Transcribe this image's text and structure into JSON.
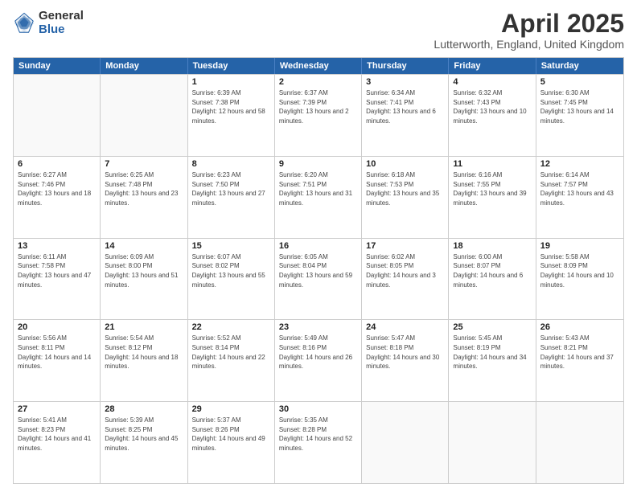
{
  "logo": {
    "general": "General",
    "blue": "Blue"
  },
  "header": {
    "month_year": "April 2025",
    "location": "Lutterworth, England, United Kingdom"
  },
  "days_of_week": [
    "Sunday",
    "Monday",
    "Tuesday",
    "Wednesday",
    "Thursday",
    "Friday",
    "Saturday"
  ],
  "weeks": [
    [
      {
        "day": "",
        "sunrise": "",
        "sunset": "",
        "daylight": ""
      },
      {
        "day": "",
        "sunrise": "",
        "sunset": "",
        "daylight": ""
      },
      {
        "day": "1",
        "sunrise": "Sunrise: 6:39 AM",
        "sunset": "Sunset: 7:38 PM",
        "daylight": "Daylight: 12 hours and 58 minutes."
      },
      {
        "day": "2",
        "sunrise": "Sunrise: 6:37 AM",
        "sunset": "Sunset: 7:39 PM",
        "daylight": "Daylight: 13 hours and 2 minutes."
      },
      {
        "day": "3",
        "sunrise": "Sunrise: 6:34 AM",
        "sunset": "Sunset: 7:41 PM",
        "daylight": "Daylight: 13 hours and 6 minutes."
      },
      {
        "day": "4",
        "sunrise": "Sunrise: 6:32 AM",
        "sunset": "Sunset: 7:43 PM",
        "daylight": "Daylight: 13 hours and 10 minutes."
      },
      {
        "day": "5",
        "sunrise": "Sunrise: 6:30 AM",
        "sunset": "Sunset: 7:45 PM",
        "daylight": "Daylight: 13 hours and 14 minutes."
      }
    ],
    [
      {
        "day": "6",
        "sunrise": "Sunrise: 6:27 AM",
        "sunset": "Sunset: 7:46 PM",
        "daylight": "Daylight: 13 hours and 18 minutes."
      },
      {
        "day": "7",
        "sunrise": "Sunrise: 6:25 AM",
        "sunset": "Sunset: 7:48 PM",
        "daylight": "Daylight: 13 hours and 23 minutes."
      },
      {
        "day": "8",
        "sunrise": "Sunrise: 6:23 AM",
        "sunset": "Sunset: 7:50 PM",
        "daylight": "Daylight: 13 hours and 27 minutes."
      },
      {
        "day": "9",
        "sunrise": "Sunrise: 6:20 AM",
        "sunset": "Sunset: 7:51 PM",
        "daylight": "Daylight: 13 hours and 31 minutes."
      },
      {
        "day": "10",
        "sunrise": "Sunrise: 6:18 AM",
        "sunset": "Sunset: 7:53 PM",
        "daylight": "Daylight: 13 hours and 35 minutes."
      },
      {
        "day": "11",
        "sunrise": "Sunrise: 6:16 AM",
        "sunset": "Sunset: 7:55 PM",
        "daylight": "Daylight: 13 hours and 39 minutes."
      },
      {
        "day": "12",
        "sunrise": "Sunrise: 6:14 AM",
        "sunset": "Sunset: 7:57 PM",
        "daylight": "Daylight: 13 hours and 43 minutes."
      }
    ],
    [
      {
        "day": "13",
        "sunrise": "Sunrise: 6:11 AM",
        "sunset": "Sunset: 7:58 PM",
        "daylight": "Daylight: 13 hours and 47 minutes."
      },
      {
        "day": "14",
        "sunrise": "Sunrise: 6:09 AM",
        "sunset": "Sunset: 8:00 PM",
        "daylight": "Daylight: 13 hours and 51 minutes."
      },
      {
        "day": "15",
        "sunrise": "Sunrise: 6:07 AM",
        "sunset": "Sunset: 8:02 PM",
        "daylight": "Daylight: 13 hours and 55 minutes."
      },
      {
        "day": "16",
        "sunrise": "Sunrise: 6:05 AM",
        "sunset": "Sunset: 8:04 PM",
        "daylight": "Daylight: 13 hours and 59 minutes."
      },
      {
        "day": "17",
        "sunrise": "Sunrise: 6:02 AM",
        "sunset": "Sunset: 8:05 PM",
        "daylight": "Daylight: 14 hours and 3 minutes."
      },
      {
        "day": "18",
        "sunrise": "Sunrise: 6:00 AM",
        "sunset": "Sunset: 8:07 PM",
        "daylight": "Daylight: 14 hours and 6 minutes."
      },
      {
        "day": "19",
        "sunrise": "Sunrise: 5:58 AM",
        "sunset": "Sunset: 8:09 PM",
        "daylight": "Daylight: 14 hours and 10 minutes."
      }
    ],
    [
      {
        "day": "20",
        "sunrise": "Sunrise: 5:56 AM",
        "sunset": "Sunset: 8:11 PM",
        "daylight": "Daylight: 14 hours and 14 minutes."
      },
      {
        "day": "21",
        "sunrise": "Sunrise: 5:54 AM",
        "sunset": "Sunset: 8:12 PM",
        "daylight": "Daylight: 14 hours and 18 minutes."
      },
      {
        "day": "22",
        "sunrise": "Sunrise: 5:52 AM",
        "sunset": "Sunset: 8:14 PM",
        "daylight": "Daylight: 14 hours and 22 minutes."
      },
      {
        "day": "23",
        "sunrise": "Sunrise: 5:49 AM",
        "sunset": "Sunset: 8:16 PM",
        "daylight": "Daylight: 14 hours and 26 minutes."
      },
      {
        "day": "24",
        "sunrise": "Sunrise: 5:47 AM",
        "sunset": "Sunset: 8:18 PM",
        "daylight": "Daylight: 14 hours and 30 minutes."
      },
      {
        "day": "25",
        "sunrise": "Sunrise: 5:45 AM",
        "sunset": "Sunset: 8:19 PM",
        "daylight": "Daylight: 14 hours and 34 minutes."
      },
      {
        "day": "26",
        "sunrise": "Sunrise: 5:43 AM",
        "sunset": "Sunset: 8:21 PM",
        "daylight": "Daylight: 14 hours and 37 minutes."
      }
    ],
    [
      {
        "day": "27",
        "sunrise": "Sunrise: 5:41 AM",
        "sunset": "Sunset: 8:23 PM",
        "daylight": "Daylight: 14 hours and 41 minutes."
      },
      {
        "day": "28",
        "sunrise": "Sunrise: 5:39 AM",
        "sunset": "Sunset: 8:25 PM",
        "daylight": "Daylight: 14 hours and 45 minutes."
      },
      {
        "day": "29",
        "sunrise": "Sunrise: 5:37 AM",
        "sunset": "Sunset: 8:26 PM",
        "daylight": "Daylight: 14 hours and 49 minutes."
      },
      {
        "day": "30",
        "sunrise": "Sunrise: 5:35 AM",
        "sunset": "Sunset: 8:28 PM",
        "daylight": "Daylight: 14 hours and 52 minutes."
      },
      {
        "day": "",
        "sunrise": "",
        "sunset": "",
        "daylight": ""
      },
      {
        "day": "",
        "sunrise": "",
        "sunset": "",
        "daylight": ""
      },
      {
        "day": "",
        "sunrise": "",
        "sunset": "",
        "daylight": ""
      }
    ]
  ]
}
